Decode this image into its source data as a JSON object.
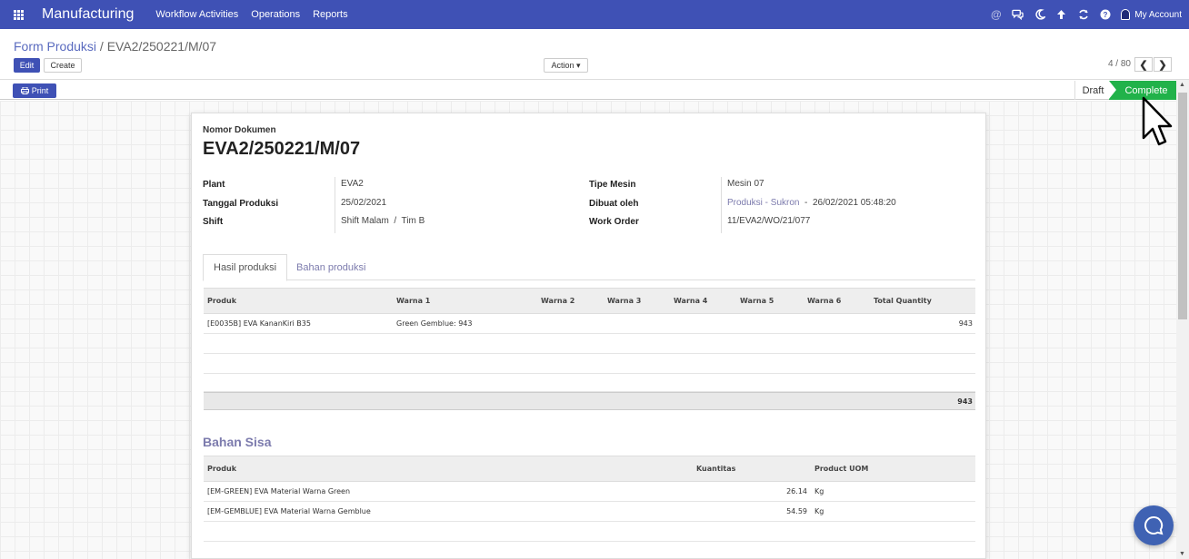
{
  "navbar": {
    "brand": "Manufacturing",
    "menu": [
      "Workflow Activities",
      "Operations",
      "Reports"
    ],
    "account": "My Account"
  },
  "breadcrumb": {
    "parent": "Form Produksi",
    "separator": " / ",
    "current": "EVA2/250221/M/07"
  },
  "buttons": {
    "edit": "Edit",
    "create": "Create",
    "action": "Action ▾",
    "print": "Print"
  },
  "pager": {
    "value": "4 / 80",
    "prev": "❮",
    "next": "❯"
  },
  "status": {
    "draft": "Draft",
    "complete": "Complete"
  },
  "document": {
    "number_label": "Nomor Dokumen",
    "number": "EVA2/250221/M/07",
    "left_fields": [
      {
        "label": "Plant",
        "value": "EVA2"
      },
      {
        "label": "Tanggal Produksi",
        "value": "25/02/2021"
      },
      {
        "label": "Shift",
        "value": "Shift Malam  /  Tim B"
      }
    ],
    "right_fields": {
      "tipe_mesin": {
        "label": "Tipe Mesin",
        "value": "Mesin 07"
      },
      "dibuat_oleh": {
        "label": "Dibuat oleh",
        "user": "Produksi - Sukron",
        "separator": "-",
        "datetime": "26/02/2021 05:48:20"
      },
      "work_order": {
        "label": "Work Order",
        "value": "11/EVA2/WO/21/077"
      }
    }
  },
  "tabs": [
    "Hasil produksi",
    "Bahan produksi"
  ],
  "hasil_table": {
    "headers": [
      "Produk",
      "Warna 1",
      "Warna 2",
      "Warna 3",
      "Warna 4",
      "Warna 5",
      "Warna 6",
      "Total Quantity"
    ],
    "rows": [
      {
        "produk": "[E0035B] EVA KananKiri B35",
        "warna1": "Green Gemblue: 943",
        "total": "943"
      }
    ],
    "footer_total": "943"
  },
  "bahan_sisa": {
    "title": "Bahan Sisa",
    "headers": [
      "Produk",
      "Kuantitas",
      "Product UOM"
    ],
    "rows": [
      {
        "produk": "[EM-GREEN] EVA Material Warna Green",
        "qty": "26.14",
        "uom": "Kg"
      },
      {
        "produk": "[EM-GEMBLUE] EVA Material Warna Gemblue",
        "qty": "54.59",
        "uom": "Kg"
      }
    ]
  },
  "colors": {
    "navbar": "#3f51b5",
    "status_active": "#21b24a",
    "link": "#7c7bad"
  }
}
